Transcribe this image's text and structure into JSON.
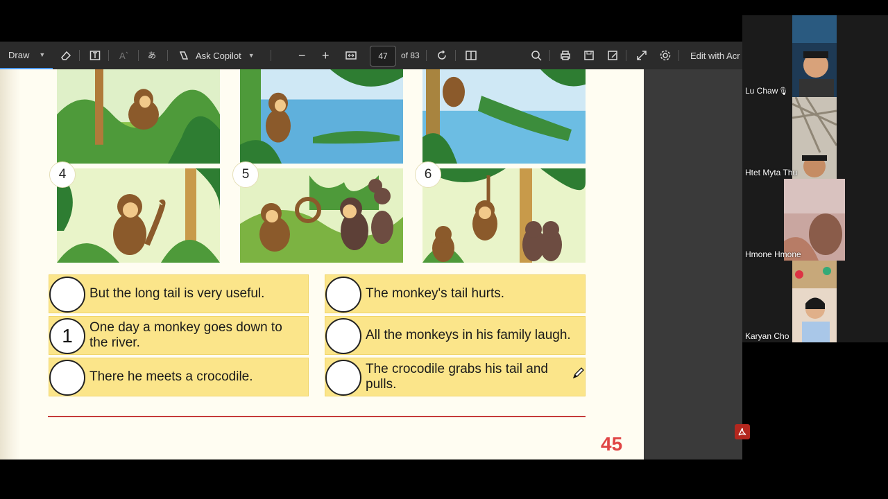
{
  "toolbar": {
    "draw_label": "Draw",
    "ask_copilot_label": "Ask Copilot",
    "page_number": "47",
    "page_total": "of 83",
    "edit_with_acrobat": "Edit with Acr"
  },
  "worksheet": {
    "picture_numbers": [
      "4",
      "5",
      "6"
    ],
    "sentences_left": [
      {
        "answer": "",
        "text": "But the long tail is very useful."
      },
      {
        "answer": "1",
        "text": "One day a monkey goes down to the river."
      },
      {
        "answer": "",
        "text": "There he meets a crocodile."
      }
    ],
    "sentences_right": [
      {
        "answer": "",
        "text": "The monkey's tail hurts."
      },
      {
        "answer": "",
        "text": "All the monkeys in his family laugh."
      },
      {
        "answer": "",
        "text": "The crocodile grabs his tail and pulls."
      }
    ],
    "page_number": "45"
  },
  "participants": [
    {
      "name": "Lu Chaw"
    },
    {
      "name": "Htet Myta Thu"
    },
    {
      "name": "Hmone Hmone"
    },
    {
      "name": "Karyan Cho"
    }
  ],
  "colors": {
    "sentence_box": "#fbe58a",
    "toolbar_bg": "#2b2b2b",
    "page_bg": "#fffdf2",
    "page_number_red": "#e04545"
  }
}
